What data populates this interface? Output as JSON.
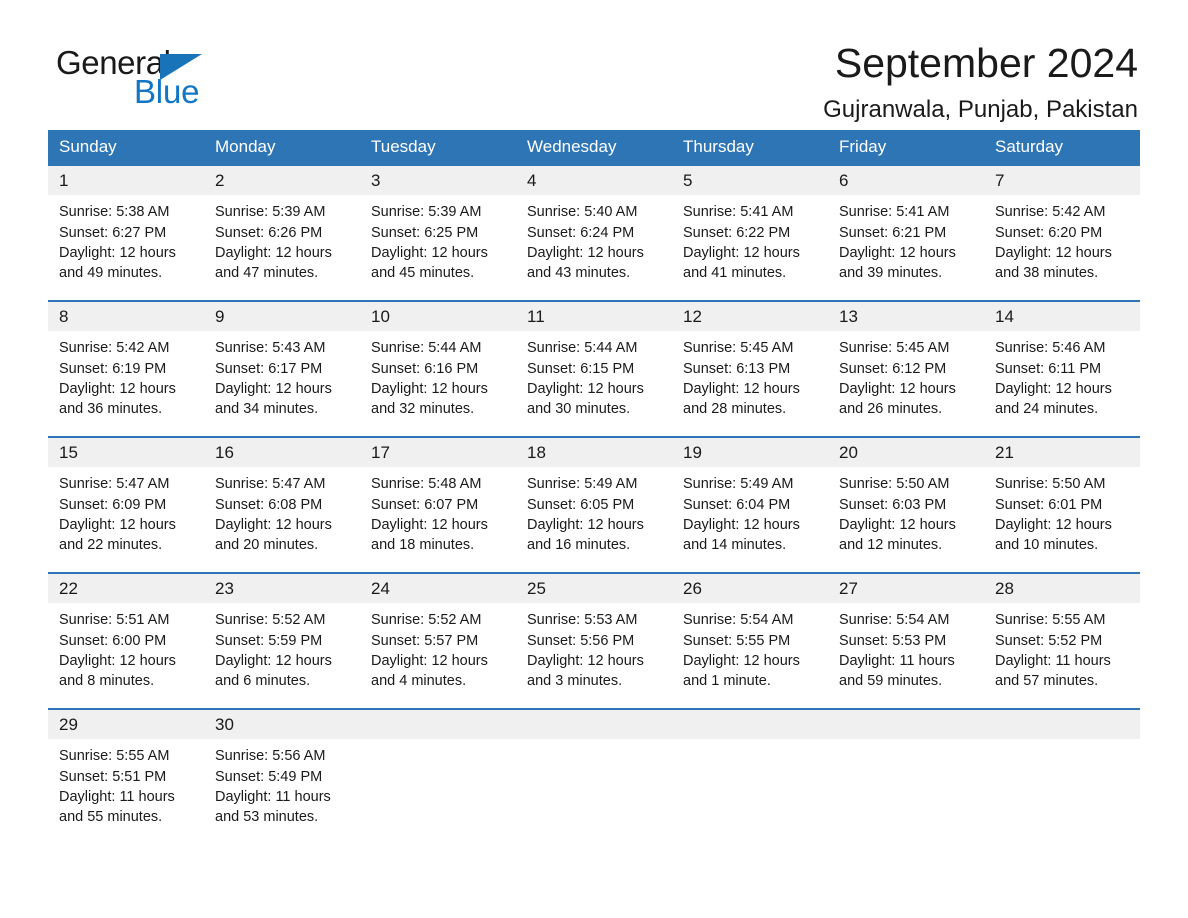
{
  "brand": {
    "name_part1": "General",
    "name_part2": "Blue",
    "triangle_color": "#1973b8",
    "blue_color": "#1276c4"
  },
  "header": {
    "title": "September 2024",
    "subtitle": "Gujranwala, Punjab, Pakistan"
  },
  "theme": {
    "header_blue": "#2e75b6",
    "daynum_gray": "#f0f0f0",
    "text_color": "#1a1a1a"
  },
  "weekday_headers": [
    "Sunday",
    "Monday",
    "Tuesday",
    "Wednesday",
    "Thursday",
    "Friday",
    "Saturday"
  ],
  "weeks": [
    [
      {
        "day": "1",
        "sunrise": "Sunrise: 5:38 AM",
        "sunset": "Sunset: 6:27 PM",
        "daylight": "Daylight: 12 hours and 49 minutes."
      },
      {
        "day": "2",
        "sunrise": "Sunrise: 5:39 AM",
        "sunset": "Sunset: 6:26 PM",
        "daylight": "Daylight: 12 hours and 47 minutes."
      },
      {
        "day": "3",
        "sunrise": "Sunrise: 5:39 AM",
        "sunset": "Sunset: 6:25 PM",
        "daylight": "Daylight: 12 hours and 45 minutes."
      },
      {
        "day": "4",
        "sunrise": "Sunrise: 5:40 AM",
        "sunset": "Sunset: 6:24 PM",
        "daylight": "Daylight: 12 hours and 43 minutes."
      },
      {
        "day": "5",
        "sunrise": "Sunrise: 5:41 AM",
        "sunset": "Sunset: 6:22 PM",
        "daylight": "Daylight: 12 hours and 41 minutes."
      },
      {
        "day": "6",
        "sunrise": "Sunrise: 5:41 AM",
        "sunset": "Sunset: 6:21 PM",
        "daylight": "Daylight: 12 hours and 39 minutes."
      },
      {
        "day": "7",
        "sunrise": "Sunrise: 5:42 AM",
        "sunset": "Sunset: 6:20 PM",
        "daylight": "Daylight: 12 hours and 38 minutes."
      }
    ],
    [
      {
        "day": "8",
        "sunrise": "Sunrise: 5:42 AM",
        "sunset": "Sunset: 6:19 PM",
        "daylight": "Daylight: 12 hours and 36 minutes."
      },
      {
        "day": "9",
        "sunrise": "Sunrise: 5:43 AM",
        "sunset": "Sunset: 6:17 PM",
        "daylight": "Daylight: 12 hours and 34 minutes."
      },
      {
        "day": "10",
        "sunrise": "Sunrise: 5:44 AM",
        "sunset": "Sunset: 6:16 PM",
        "daylight": "Daylight: 12 hours and 32 minutes."
      },
      {
        "day": "11",
        "sunrise": "Sunrise: 5:44 AM",
        "sunset": "Sunset: 6:15 PM",
        "daylight": "Daylight: 12 hours and 30 minutes."
      },
      {
        "day": "12",
        "sunrise": "Sunrise: 5:45 AM",
        "sunset": "Sunset: 6:13 PM",
        "daylight": "Daylight: 12 hours and 28 minutes."
      },
      {
        "day": "13",
        "sunrise": "Sunrise: 5:45 AM",
        "sunset": "Sunset: 6:12 PM",
        "daylight": "Daylight: 12 hours and 26 minutes."
      },
      {
        "day": "14",
        "sunrise": "Sunrise: 5:46 AM",
        "sunset": "Sunset: 6:11 PM",
        "daylight": "Daylight: 12 hours and 24 minutes."
      }
    ],
    [
      {
        "day": "15",
        "sunrise": "Sunrise: 5:47 AM",
        "sunset": "Sunset: 6:09 PM",
        "daylight": "Daylight: 12 hours and 22 minutes."
      },
      {
        "day": "16",
        "sunrise": "Sunrise: 5:47 AM",
        "sunset": "Sunset: 6:08 PM",
        "daylight": "Daylight: 12 hours and 20 minutes."
      },
      {
        "day": "17",
        "sunrise": "Sunrise: 5:48 AM",
        "sunset": "Sunset: 6:07 PM",
        "daylight": "Daylight: 12 hours and 18 minutes."
      },
      {
        "day": "18",
        "sunrise": "Sunrise: 5:49 AM",
        "sunset": "Sunset: 6:05 PM",
        "daylight": "Daylight: 12 hours and 16 minutes."
      },
      {
        "day": "19",
        "sunrise": "Sunrise: 5:49 AM",
        "sunset": "Sunset: 6:04 PM",
        "daylight": "Daylight: 12 hours and 14 minutes."
      },
      {
        "day": "20",
        "sunrise": "Sunrise: 5:50 AM",
        "sunset": "Sunset: 6:03 PM",
        "daylight": "Daylight: 12 hours and 12 minutes."
      },
      {
        "day": "21",
        "sunrise": "Sunrise: 5:50 AM",
        "sunset": "Sunset: 6:01 PM",
        "daylight": "Daylight: 12 hours and 10 minutes."
      }
    ],
    [
      {
        "day": "22",
        "sunrise": "Sunrise: 5:51 AM",
        "sunset": "Sunset: 6:00 PM",
        "daylight": "Daylight: 12 hours and 8 minutes."
      },
      {
        "day": "23",
        "sunrise": "Sunrise: 5:52 AM",
        "sunset": "Sunset: 5:59 PM",
        "daylight": "Daylight: 12 hours and 6 minutes."
      },
      {
        "day": "24",
        "sunrise": "Sunrise: 5:52 AM",
        "sunset": "Sunset: 5:57 PM",
        "daylight": "Daylight: 12 hours and 4 minutes."
      },
      {
        "day": "25",
        "sunrise": "Sunrise: 5:53 AM",
        "sunset": "Sunset: 5:56 PM",
        "daylight": "Daylight: 12 hours and 3 minutes."
      },
      {
        "day": "26",
        "sunrise": "Sunrise: 5:54 AM",
        "sunset": "Sunset: 5:55 PM",
        "daylight": "Daylight: 12 hours and 1 minute."
      },
      {
        "day": "27",
        "sunrise": "Sunrise: 5:54 AM",
        "sunset": "Sunset: 5:53 PM",
        "daylight": "Daylight: 11 hours and 59 minutes."
      },
      {
        "day": "28",
        "sunrise": "Sunrise: 5:55 AM",
        "sunset": "Sunset: 5:52 PM",
        "daylight": "Daylight: 11 hours and 57 minutes."
      }
    ],
    [
      {
        "day": "29",
        "sunrise": "Sunrise: 5:55 AM",
        "sunset": "Sunset: 5:51 PM",
        "daylight": "Daylight: 11 hours and 55 minutes."
      },
      {
        "day": "30",
        "sunrise": "Sunrise: 5:56 AM",
        "sunset": "Sunset: 5:49 PM",
        "daylight": "Daylight: 11 hours and 53 minutes."
      },
      {
        "day": "",
        "sunrise": "",
        "sunset": "",
        "daylight": ""
      },
      {
        "day": "",
        "sunrise": "",
        "sunset": "",
        "daylight": ""
      },
      {
        "day": "",
        "sunrise": "",
        "sunset": "",
        "daylight": ""
      },
      {
        "day": "",
        "sunrise": "",
        "sunset": "",
        "daylight": ""
      },
      {
        "day": "",
        "sunrise": "",
        "sunset": "",
        "daylight": ""
      }
    ]
  ]
}
